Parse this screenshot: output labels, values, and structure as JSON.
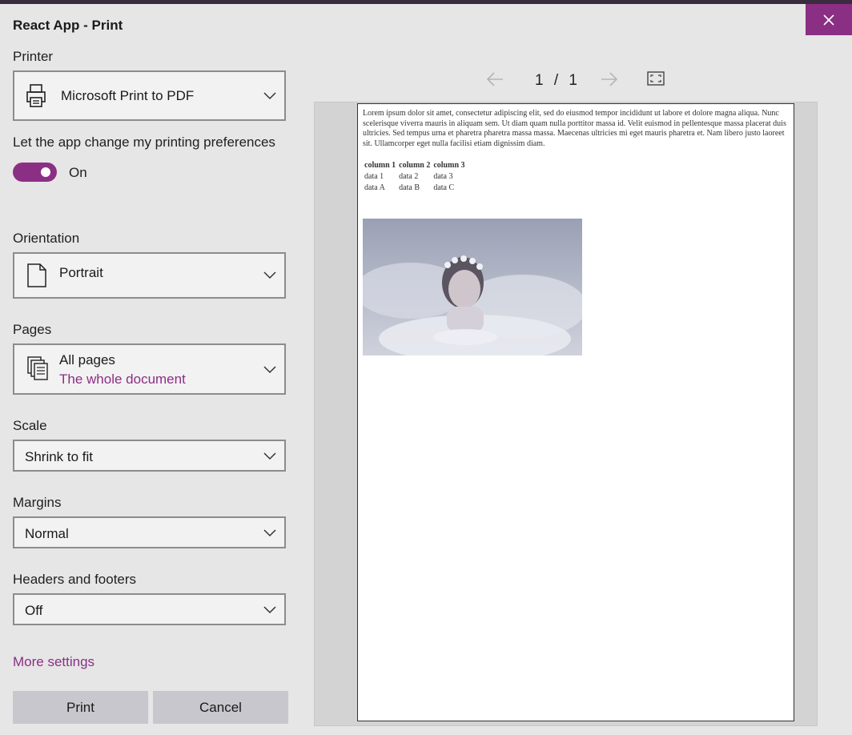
{
  "dialog": {
    "title": "React App - Print"
  },
  "printer": {
    "label": "Printer",
    "value": "Microsoft Print to PDF"
  },
  "preferences": {
    "label": "Let the app change my printing preferences",
    "toggle_state": "On",
    "enabled": true
  },
  "orientation": {
    "label": "Orientation",
    "value": "Portrait"
  },
  "pages": {
    "label": "Pages",
    "value": "All pages",
    "subtext": "The whole document"
  },
  "scale": {
    "label": "Scale",
    "value": "Shrink to fit"
  },
  "margins": {
    "label": "Margins",
    "value": "Normal"
  },
  "headers": {
    "label": "Headers and footers",
    "value": "Off"
  },
  "more_settings": "More settings",
  "buttons": {
    "print": "Print",
    "cancel": "Cancel"
  },
  "preview": {
    "current_page": "1",
    "separator": "/",
    "total_pages": "1",
    "body_text": "Lorem ipsum dolor sit amet, consectetur adipiscing elit, sed do eiusmod tempor incididunt ut labore et dolore magna aliqua. Nunc scelerisque viverra mauris in aliquam sem. Ut diam quam nulla porttitor massa id. Velit euismod in pellentesque massa placerat duis ultricies. Sed tempus urna et pharetra pharetra massa massa. Maecenas ultricies mi eget mauris pharetra et. Nam libero justo laoreet sit. Ullamcorper eget nulla facilisi etiam dignissim diam.",
    "table": {
      "headers": [
        "column 1",
        "column 2",
        "column 3"
      ],
      "rows": [
        [
          "data 1",
          "data 2",
          "data 3"
        ],
        [
          "data A",
          "data B",
          "data C"
        ]
      ]
    }
  },
  "colors": {
    "accent": "#8b2f84",
    "background": "#e6e6e6",
    "preview_bg": "#d3d3d3"
  },
  "icons": [
    "close-icon",
    "printer-icon",
    "chevron-down-icon",
    "page-portrait-icon",
    "pages-stack-icon",
    "arrow-left-icon",
    "arrow-right-icon",
    "fit-page-icon"
  ]
}
